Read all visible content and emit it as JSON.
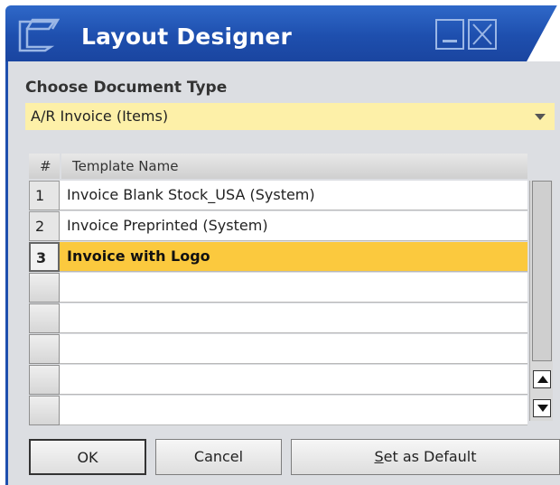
{
  "window": {
    "title": "Layout Designer",
    "accent_color": "#1e4fae"
  },
  "document_type": {
    "label": "Choose Document Type",
    "value": "A/R Invoice (Items)"
  },
  "table": {
    "headers": [
      "#",
      "Template Name"
    ],
    "rows": [
      {
        "num": "1",
        "name": "Invoice Blank Stock_USA (System)"
      },
      {
        "num": "2",
        "name": "Invoice Preprinted (System)"
      },
      {
        "num": "3",
        "name": "Invoice with Logo"
      }
    ],
    "selected_row": 3,
    "selected_color": "#fbc93e"
  },
  "buttons": {
    "ok": "OK",
    "cancel": "Cancel",
    "set_default_prefix": "S",
    "set_default_rest": "et as Default"
  },
  "icons": [
    "app-window-icon",
    "minimize-icon",
    "maximize-icon",
    "scroll-up-icon",
    "scroll-down-icon",
    "dropdown-arrow-icon"
  ]
}
